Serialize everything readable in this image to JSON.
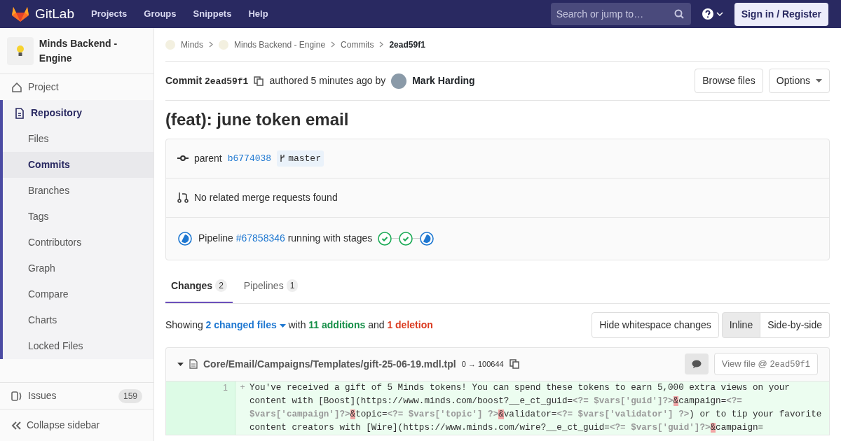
{
  "navbar": {
    "brand": "GitLab",
    "links": [
      "Projects",
      "Groups",
      "Snippets",
      "Help"
    ],
    "search": {
      "placeholder": "Search or jump to…"
    },
    "sign_in": "Sign in / Register"
  },
  "sidebar": {
    "project_name": "Minds Backend - Engine",
    "items": [
      {
        "label": "Project",
        "selected": false
      },
      {
        "label": "Repository",
        "selected": true,
        "children": [
          {
            "label": "Files",
            "selected": false
          },
          {
            "label": "Commits",
            "selected": true
          },
          {
            "label": "Branches",
            "selected": false
          },
          {
            "label": "Tags",
            "selected": false
          },
          {
            "label": "Contributors",
            "selected": false
          },
          {
            "label": "Graph",
            "selected": false
          },
          {
            "label": "Compare",
            "selected": false
          },
          {
            "label": "Charts",
            "selected": false
          },
          {
            "label": "Locked Files",
            "selected": false
          }
        ]
      },
      {
        "label": "Issues",
        "selected": false,
        "count": "159"
      }
    ],
    "collapse": "Collapse sidebar"
  },
  "breadcrumbs": [
    {
      "label": "Minds",
      "avatar": true
    },
    {
      "label": "Minds Backend - Engine",
      "avatar": true
    },
    {
      "label": "Commits",
      "avatar": false
    },
    {
      "label": "2ead59f1",
      "avatar": false
    }
  ],
  "commit": {
    "label": "Commit",
    "sha": "2ead59f1",
    "authored": "authored 5 minutes ago by",
    "author": "Mark Harding",
    "buttons": [
      "Browse files",
      "Options"
    ],
    "title": "(feat): june token email"
  },
  "info": {
    "parent_label": "parent",
    "parent_sha": "b6774038",
    "branch": "master",
    "merge_requests": "No related merge requests found",
    "pipeline_label": "Pipeline",
    "pipeline_id": "#67858346",
    "pipeline_text": "running with stages",
    "stages": [
      {
        "kind": "success"
      },
      {
        "kind": "success"
      },
      {
        "kind": "running"
      }
    ]
  },
  "tabs": [
    {
      "label": "Changes",
      "count": "2",
      "selected": true
    },
    {
      "label": "Pipelines",
      "count": "1",
      "selected": false
    }
  ],
  "summary": {
    "showing": "Showing",
    "files": "2 changed files",
    "with": "with",
    "additions": "11 additions",
    "and": "and",
    "deletions": "1 deletion"
  },
  "view_buttons": [
    {
      "label": "Hide whitespace changes",
      "selected": false
    },
    {
      "label": "Inline",
      "selected": true
    },
    {
      "label": "Side-by-side",
      "selected": false
    }
  ],
  "file": {
    "path": "Core/Email/Campaigns/Templates/gift-25-06-19.mdl.tpl",
    "mode": "0 → 100644",
    "view_file": "View file @",
    "view_sha": "2ead59f1",
    "lines": [
      {
        "new_number": "1",
        "marker": "+",
        "segments": [
          {
            "kind": "text",
            "text": "You've received a gift of 5 Minds tokens! You can spend these tokens to earn 5,000 extra views on your content with [Boost](https://www.minds.com/boost?__e_ct_guid="
          },
          {
            "kind": "php",
            "text": "<?= $vars['guid']?>"
          },
          {
            "kind": "amp",
            "text": "&"
          },
          {
            "kind": "text",
            "text": "campaign="
          },
          {
            "kind": "php",
            "text": "<?= $vars['campaign']?>"
          },
          {
            "kind": "amp",
            "text": "&"
          },
          {
            "kind": "text",
            "text": "topic="
          },
          {
            "kind": "php",
            "text": "<?= $vars['topic'] ?>"
          },
          {
            "kind": "amp",
            "text": "&"
          },
          {
            "kind": "text",
            "text": "validator="
          },
          {
            "kind": "php",
            "text": "<?= $vars['validator'] ?>"
          },
          {
            "kind": "text",
            "text": ") or to tip your favorite content creators with [Wire](https://www.minds.com/wire?__e_ct_guid="
          },
          {
            "kind": "php",
            "text": "<?= $vars['guid']?>"
          },
          {
            "kind": "amp",
            "text": "&"
          },
          {
            "kind": "text",
            "text": "campaign="
          }
        ]
      }
    ]
  }
}
